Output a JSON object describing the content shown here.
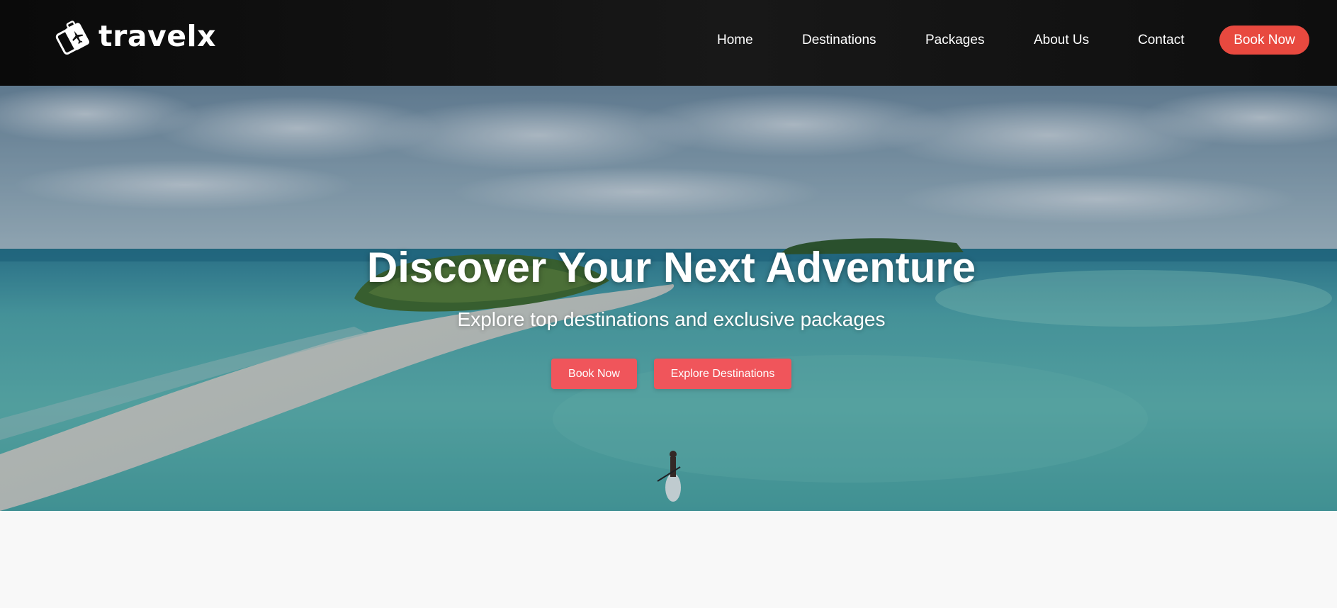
{
  "brand": {
    "name": "travelx",
    "logo_icon": "luggage-plane-icon",
    "colors": {
      "accent": "#e8493f",
      "hero_button": "#f0555b",
      "nav_bg": "#111111"
    }
  },
  "nav": {
    "items": [
      {
        "label": "Home"
      },
      {
        "label": "Destinations"
      },
      {
        "label": "Packages"
      },
      {
        "label": "About Us"
      },
      {
        "label": "Contact"
      }
    ],
    "cta_label": "Book Now"
  },
  "hero": {
    "title": "Discover Your Next Adventure",
    "subtitle": "Explore top destinations and exclusive packages",
    "primary_button": "Book Now",
    "secondary_button": "Explore Destinations",
    "background": "tropical-island-aerial-photo"
  }
}
